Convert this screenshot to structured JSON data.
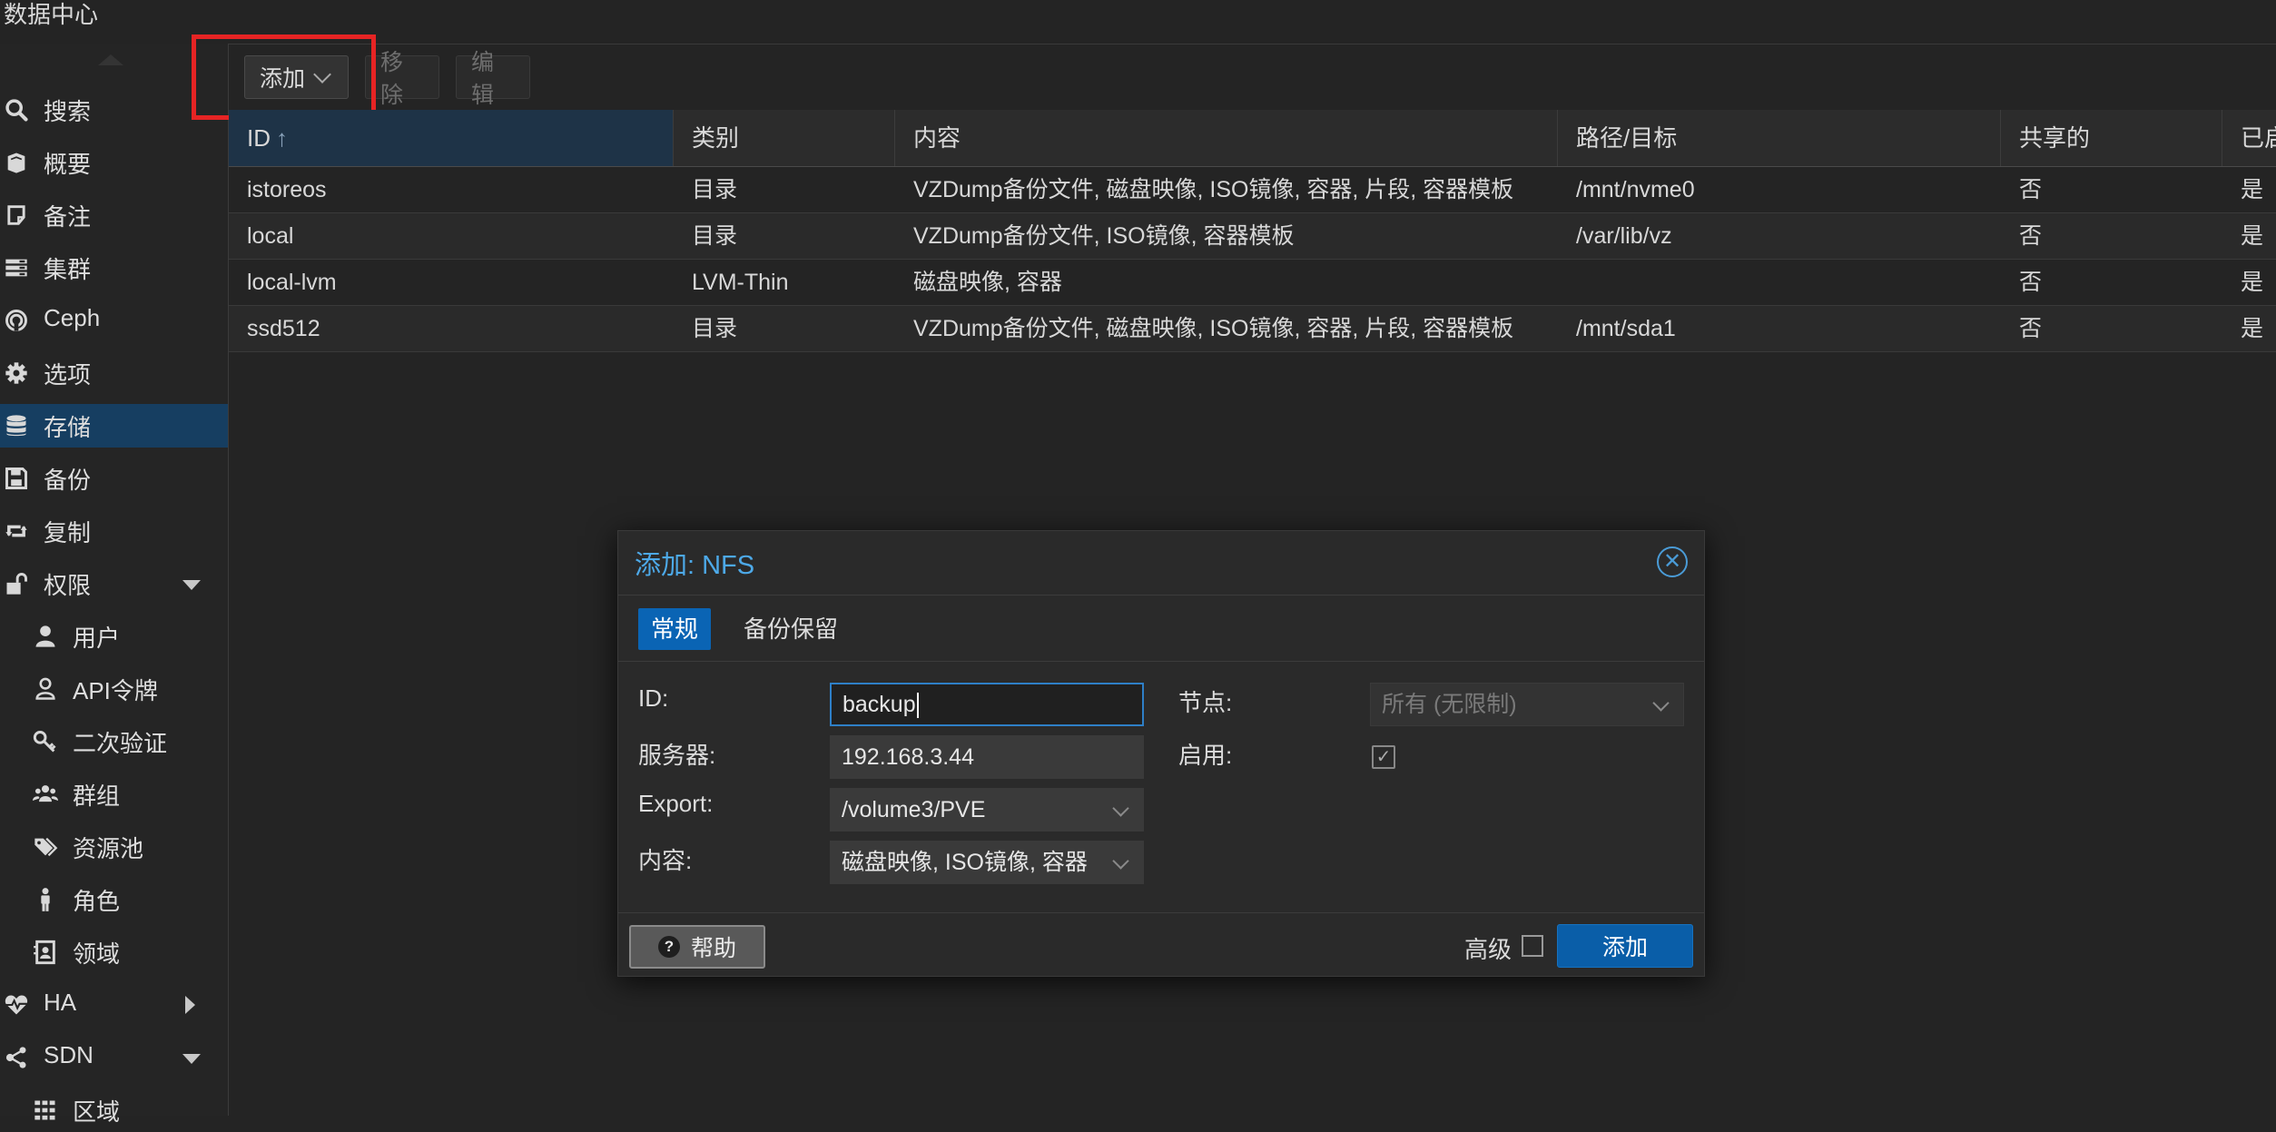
{
  "window": {
    "title": "数据中心"
  },
  "sidebar": {
    "items": [
      {
        "label": "搜索",
        "icon": "search-icon"
      },
      {
        "label": "概要",
        "icon": "book-icon"
      },
      {
        "label": "备注",
        "icon": "note-icon"
      },
      {
        "label": "集群",
        "icon": "server-icon"
      },
      {
        "label": "Ceph",
        "icon": "ceph-icon"
      },
      {
        "label": "选项",
        "icon": "gear-icon"
      },
      {
        "label": "存储",
        "icon": "database-icon",
        "active": true
      },
      {
        "label": "备份",
        "icon": "floppy-icon"
      },
      {
        "label": "复制",
        "icon": "retweet-icon"
      },
      {
        "label": "权限",
        "icon": "unlock-icon",
        "expander": "down"
      },
      {
        "label": "用户",
        "icon": "user-icon"
      },
      {
        "label": "API令牌",
        "icon": "user-outline-icon"
      },
      {
        "label": "二次验证",
        "icon": "key-icon"
      },
      {
        "label": "群组",
        "icon": "users-icon"
      },
      {
        "label": "资源池",
        "icon": "tags-icon"
      },
      {
        "label": "角色",
        "icon": "male-icon"
      },
      {
        "label": "领域",
        "icon": "address-book-icon"
      },
      {
        "label": "HA",
        "icon": "heartbeat-icon",
        "expander": "right"
      },
      {
        "label": "SDN",
        "icon": "sdn-icon",
        "expander": "down"
      },
      {
        "label": "区域",
        "icon": "grid-icon"
      }
    ]
  },
  "toolbar": {
    "add_label": "添加",
    "remove_label": "移除",
    "edit_label": "编辑"
  },
  "grid": {
    "columns": [
      "ID",
      "类别",
      "内容",
      "路径/目标",
      "共享的",
      "已启用"
    ],
    "sort_indicator": "↑",
    "rows": [
      [
        "istoreos",
        "目录",
        "VZDump备份文件, 磁盘映像, ISO镜像, 容器, 片段, 容器模板",
        "/mnt/nvme0",
        "否",
        "是"
      ],
      [
        "local",
        "目录",
        "VZDump备份文件, ISO镜像, 容器模板",
        "/var/lib/vz",
        "否",
        "是"
      ],
      [
        "local-lvm",
        "LVM-Thin",
        "磁盘映像, 容器",
        "",
        "否",
        "是"
      ],
      [
        "ssd512",
        "目录",
        "VZDump备份文件, 磁盘映像, ISO镜像, 容器, 片段, 容器模板",
        "/mnt/sda1",
        "否",
        "是"
      ]
    ]
  },
  "dialog": {
    "title": "添加: NFS",
    "close_glyph": "✕",
    "tabs": [
      "常规",
      "备份保留"
    ],
    "fields": {
      "id_label": "ID:",
      "id_value": "backup",
      "server_label": "服务器:",
      "server_value": "192.168.3.44",
      "export_label": "Export:",
      "export_value": "/volume3/PVE",
      "content_label": "内容:",
      "content_value": "磁盘映像, ISO镜像, 容器",
      "node_label": "节点:",
      "node_value": "所有 (无限制)",
      "enable_label": "启用:",
      "enable_checked": true
    },
    "footer": {
      "help_label": "帮助",
      "advanced_label": "高级",
      "submit_label": "添加"
    }
  },
  "colors": {
    "accent": "#0a64b4",
    "title_blue": "#4da9e8",
    "highlight_box": "#e62424",
    "active_nav": "#163e61"
  }
}
